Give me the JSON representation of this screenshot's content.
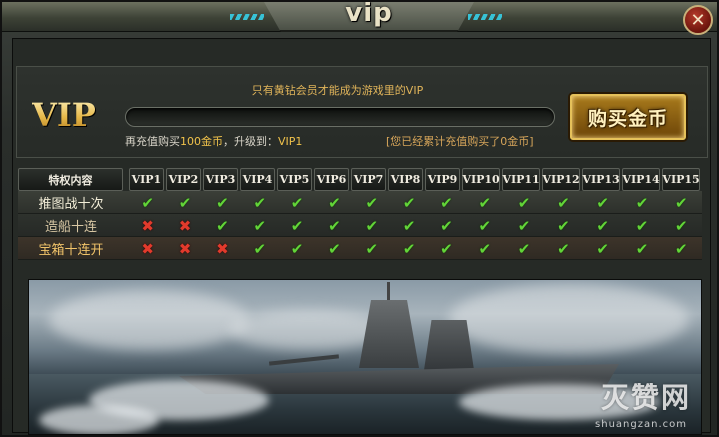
{
  "window": {
    "title": "vip",
    "close_label": "✕"
  },
  "top_panel": {
    "logo": "VIP",
    "notice": "只有黄钻会员才能成为游戏里的VIP",
    "progress": 0.0,
    "recharge_prefix": "再充值购买",
    "recharge_amount": "100金币",
    "recharge_middle": "，升级到：",
    "recharge_target": "VIP1",
    "total_text": "[您已经累计充值购买了0金币]",
    "buy_button_label": "购买金币"
  },
  "table": {
    "header_first": "特权内容",
    "columns": [
      "VIP1",
      "VIP2",
      "VIP3",
      "VIP4",
      "VIP5",
      "VIP6",
      "VIP7",
      "VIP8",
      "VIP9",
      "VIP10",
      "VIP11",
      "VIP12",
      "VIP13",
      "VIP14",
      "VIP15"
    ],
    "rows": [
      {
        "label": "推图战十次",
        "marks": [
          "check",
          "check",
          "check",
          "check",
          "check",
          "check",
          "check",
          "check",
          "check",
          "check",
          "check",
          "check",
          "check",
          "check",
          "check"
        ]
      },
      {
        "label": "造船十连",
        "marks": [
          "cross",
          "cross",
          "check",
          "check",
          "check",
          "check",
          "check",
          "check",
          "check",
          "check",
          "check",
          "check",
          "check",
          "check",
          "check"
        ]
      },
      {
        "label": "宝箱十连开",
        "marks": [
          "cross",
          "cross",
          "cross",
          "check",
          "check",
          "check",
          "check",
          "check",
          "check",
          "check",
          "check",
          "check",
          "check",
          "check",
          "check"
        ]
      }
    ],
    "check_glyph": "✔",
    "cross_glyph": "✖",
    "colors": {
      "check": "#62d438",
      "cross": "#e23a2c"
    }
  },
  "banner": {
    "watermark": "灭赞网",
    "watermark_sub": "shuangzan.com"
  }
}
